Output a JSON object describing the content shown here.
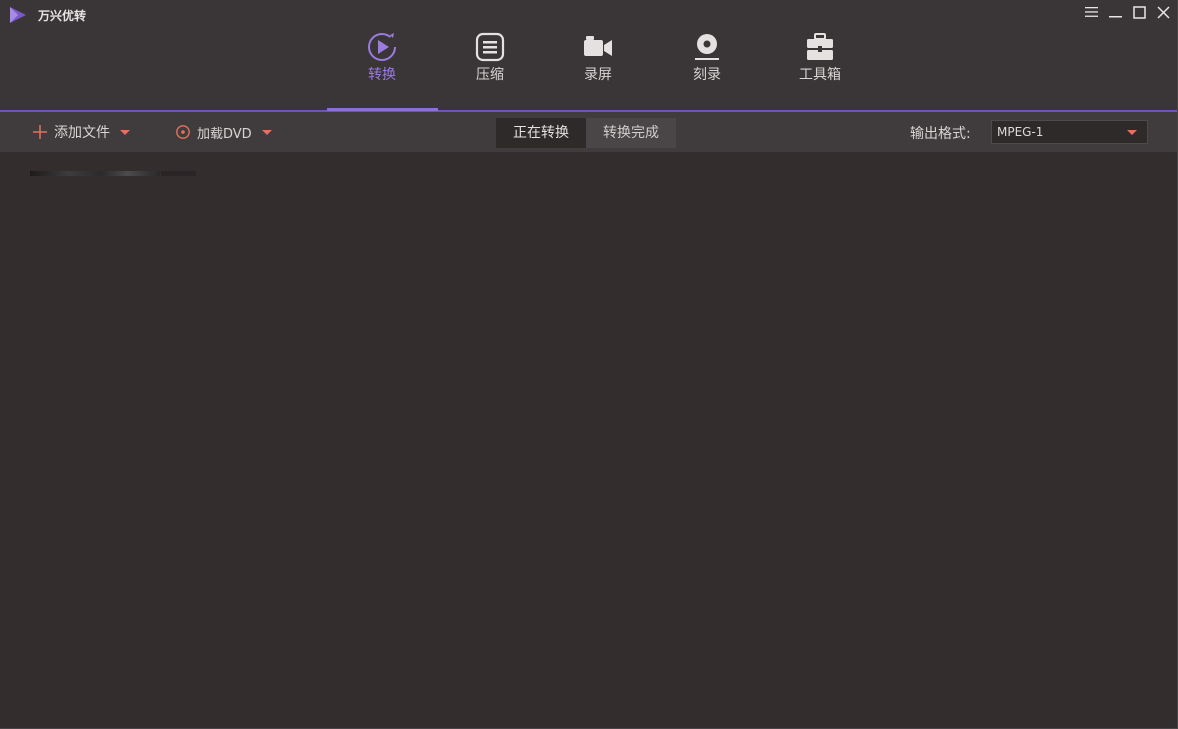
{
  "app": {
    "title": "万兴优转"
  },
  "window_controls": {
    "menu": "☰",
    "minimize": "—",
    "maximize": "☐",
    "close": "✕"
  },
  "nav": {
    "items": [
      {
        "label": "转换",
        "icon": "convert-play-icon",
        "active": true
      },
      {
        "label": "压缩",
        "icon": "compress-icon",
        "active": false
      },
      {
        "label": "录屏",
        "icon": "camera-record-icon",
        "active": false
      },
      {
        "label": "刻录",
        "icon": "disc-burn-icon",
        "active": false
      },
      {
        "label": "工具箱",
        "icon": "toolbox-icon",
        "active": false
      }
    ]
  },
  "toolbar": {
    "add_file_label": "添加文件",
    "load_dvd_label": "加载DVD",
    "segments": [
      {
        "label": "正在转换",
        "active": true
      },
      {
        "label": "转换完成",
        "active": false
      }
    ],
    "output_label": "输出格式:",
    "output_value": "MPEG-1"
  },
  "colors": {
    "accent": "#8c6fd8",
    "orange": "#e2725b",
    "background": "#332e2d"
  }
}
